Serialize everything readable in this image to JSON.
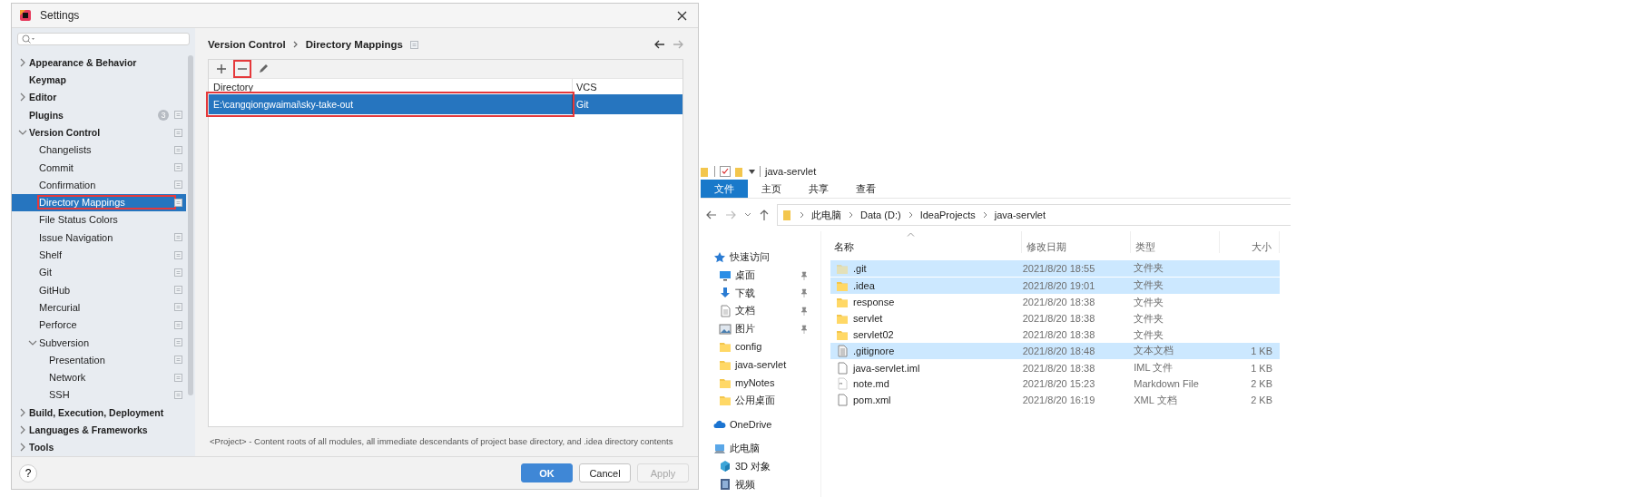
{
  "settings": {
    "title": "Settings",
    "sidebar": [
      {
        "label": "Appearance & Behavior",
        "expanded": false,
        "selected": false,
        "highlighted": false,
        "project_scoped": false
      },
      {
        "label": "Keymap",
        "selected": false,
        "highlighted": false,
        "project_scoped": false
      },
      {
        "label": "Editor",
        "expanded": false,
        "selected": false,
        "highlighted": false,
        "project_scoped": false
      },
      {
        "label": "Plugins",
        "badge": "3",
        "selected": false,
        "highlighted": false,
        "project_scoped": true
      },
      {
        "label": "Version Control",
        "expanded": true,
        "selected": false,
        "highlighted": false,
        "project_scoped": true,
        "children": [
          {
            "label": "Changelists",
            "selected": false,
            "highlighted": false,
            "project_scoped": true
          },
          {
            "label": "Commit",
            "selected": false,
            "highlighted": false,
            "project_scoped": true
          },
          {
            "label": "Confirmation",
            "selected": false,
            "highlighted": false,
            "project_scoped": true
          },
          {
            "label": "Directory Mappings",
            "selected": true,
            "highlighted": true,
            "project_scoped": true
          },
          {
            "label": "File Status Colors",
            "selected": false,
            "highlighted": false,
            "project_scoped": false
          },
          {
            "label": "Issue Navigation",
            "selected": false,
            "highlighted": false,
            "project_scoped": true
          },
          {
            "label": "Shelf",
            "selected": false,
            "highlighted": false,
            "project_scoped": true
          },
          {
            "label": "Git",
            "selected": false,
            "highlighted": false,
            "project_scoped": true
          },
          {
            "label": "GitHub",
            "selected": false,
            "highlighted": false,
            "project_scoped": true
          },
          {
            "label": "Mercurial",
            "selected": false,
            "highlighted": false,
            "project_scoped": true
          },
          {
            "label": "Perforce",
            "selected": false,
            "highlighted": false,
            "project_scoped": true
          },
          {
            "label": "Subversion",
            "expanded": true,
            "selected": false,
            "highlighted": false,
            "project_scoped": true,
            "children": [
              {
                "label": "Presentation",
                "selected": false,
                "highlighted": false,
                "project_scoped": true
              },
              {
                "label": "Network",
                "selected": false,
                "highlighted": false,
                "project_scoped": true
              },
              {
                "label": "SSH",
                "selected": false,
                "highlighted": false,
                "project_scoped": true
              }
            ]
          }
        ]
      },
      {
        "label": "Build, Execution, Deployment",
        "expanded": false,
        "selected": false,
        "highlighted": false,
        "project_scoped": false
      },
      {
        "label": "Languages & Frameworks",
        "expanded": false,
        "selected": false,
        "highlighted": false,
        "project_scoped": false
      },
      {
        "label": "Tools",
        "expanded": false,
        "selected": false,
        "highlighted": false,
        "project_scoped": false
      }
    ],
    "breadcrumb": [
      "Version Control",
      "Directory Mappings"
    ],
    "toolbar": [
      {
        "kind": "add",
        "highlighted": false
      },
      {
        "kind": "remove",
        "highlighted": true
      },
      {
        "kind": "edit",
        "highlighted": false
      }
    ],
    "table": {
      "columns": [
        "Directory",
        "VCS"
      ],
      "rows": [
        {
          "cells": [
            "E:\\cangqiongwaimai\\sky-take-out",
            "Git"
          ],
          "selected": true,
          "highlighted": true
        }
      ]
    },
    "footnote": "<Project> - Content roots of all modules, all immediate descendants of project base directory, and .idea directory contents",
    "help": "?",
    "buttons": [
      {
        "label": "OK",
        "kind": "primary",
        "disabled": false
      },
      {
        "label": "Cancel",
        "kind": "normal",
        "disabled": false
      },
      {
        "label": "Apply",
        "kind": "normal",
        "disabled": true
      }
    ]
  },
  "explorer": {
    "title": "java-servlet",
    "ribbon_tabs": [
      {
        "label": "文件",
        "selected": true
      },
      {
        "label": "主页",
        "selected": false
      },
      {
        "label": "共享",
        "selected": false
      },
      {
        "label": "查看",
        "selected": false
      }
    ],
    "address": [
      "此电脑",
      "Data (D:)",
      "IdeaProjects",
      "java-servlet"
    ],
    "nav": [
      {
        "label": "快速访问",
        "kind": "star",
        "children": [
          {
            "label": "桌面",
            "kind": "desktop",
            "pinned": true
          },
          {
            "label": "下载",
            "kind": "download",
            "pinned": true
          },
          {
            "label": "文档",
            "kind": "document",
            "pinned": true
          },
          {
            "label": "图片",
            "kind": "pictures",
            "pinned": true
          },
          {
            "label": "config",
            "kind": "folder",
            "pinned": false
          },
          {
            "label": "java-servlet",
            "kind": "folder",
            "pinned": false
          },
          {
            "label": "myNotes",
            "kind": "folder",
            "pinned": false
          },
          {
            "label": "公用桌面",
            "kind": "folder",
            "pinned": false
          }
        ]
      },
      {
        "label": "OneDrive",
        "kind": "cloud"
      },
      {
        "label": "此电脑",
        "kind": "computer",
        "children": [
          {
            "label": "3D 对象",
            "kind": "cube",
            "pinned": false
          },
          {
            "label": "视频",
            "kind": "video",
            "pinned": false
          }
        ]
      }
    ],
    "columns": [
      "名称",
      "修改日期",
      "类型",
      "大小"
    ],
    "files": [
      {
        "name": ".git",
        "date": "2021/8/20 18:55",
        "type": "文件夹",
        "kind": "folder",
        "hidden": true,
        "selected": true
      },
      {
        "name": ".idea",
        "date": "2021/8/20 19:01",
        "type": "文件夹",
        "kind": "folder",
        "hidden": false,
        "selected": true
      },
      {
        "name": "response",
        "date": "2021/8/20 18:38",
        "type": "文件夹",
        "kind": "folder",
        "hidden": false,
        "selected": false
      },
      {
        "name": "servlet",
        "date": "2021/8/20 18:38",
        "type": "文件夹",
        "kind": "folder",
        "hidden": false,
        "selected": false
      },
      {
        "name": "servlet02",
        "date": "2021/8/20 18:38",
        "type": "文件夹",
        "kind": "folder",
        "hidden": false,
        "selected": false
      },
      {
        "name": ".gitignore",
        "date": "2021/8/20 18:48",
        "type": "文本文档",
        "size": "1 KB",
        "kind": "text",
        "hidden": false,
        "selected": true
      },
      {
        "name": "java-servlet.iml",
        "date": "2021/8/20 18:38",
        "type": "IML 文件",
        "size": "1 KB",
        "kind": "file",
        "hidden": false,
        "selected": false
      },
      {
        "name": "note.md",
        "date": "2021/8/20 15:23",
        "type": "Markdown File",
        "size": "2 KB",
        "kind": "markdown",
        "hidden": false,
        "selected": false
      },
      {
        "name": "pom.xml",
        "date": "2021/8/20 16:19",
        "type": "XML 文档",
        "size": "2 KB",
        "kind": "file",
        "hidden": false,
        "selected": false
      }
    ]
  }
}
